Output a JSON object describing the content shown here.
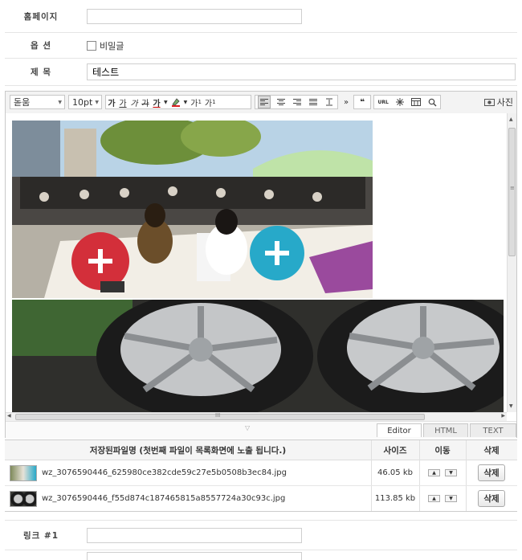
{
  "form": {
    "homepage": {
      "label": "홈페이지",
      "value": ""
    },
    "options": {
      "label": "옵 션",
      "secret_label": "비밀글"
    },
    "subject": {
      "label": "제 목",
      "value": "테스트"
    },
    "link1": {
      "label": "링크 #1",
      "value": ""
    }
  },
  "editor": {
    "font_family": "돋움",
    "font_size": "10pt",
    "format_buttons": [
      "가",
      "가",
      "가",
      "가",
      "가"
    ],
    "superscript": "가",
    "subscript": "가",
    "sup_mark": "1",
    "sub_mark": "1",
    "more_label": "»",
    "quote_label": "❝",
    "url_label": "URL",
    "photo_label": "사진",
    "hscroll_label": "III",
    "vscroll_label": "≡",
    "tabs": {
      "editor": "Editor",
      "html": "HTML",
      "text": "TEXT"
    }
  },
  "files": {
    "columns": {
      "name": "저장된파일명 (첫번째 파일이 목록화면에 노출 됩니다.)",
      "size": "사이즈",
      "move": "이동",
      "delete": "삭제"
    },
    "rows": [
      {
        "name": "wz_3076590446_625980ce382cde59c27e5b0508b3ec84.jpg",
        "size": "46.05 kb",
        "delete": "삭제"
      },
      {
        "name": "wz_3076590446_f55d874c187465815a8557724a30c93c.jpg",
        "size": "113.85 kb",
        "delete": "삭제"
      }
    ]
  },
  "colors": {
    "border": "#cfcfcf",
    "toolbar_bg": "#f3f3f3"
  }
}
